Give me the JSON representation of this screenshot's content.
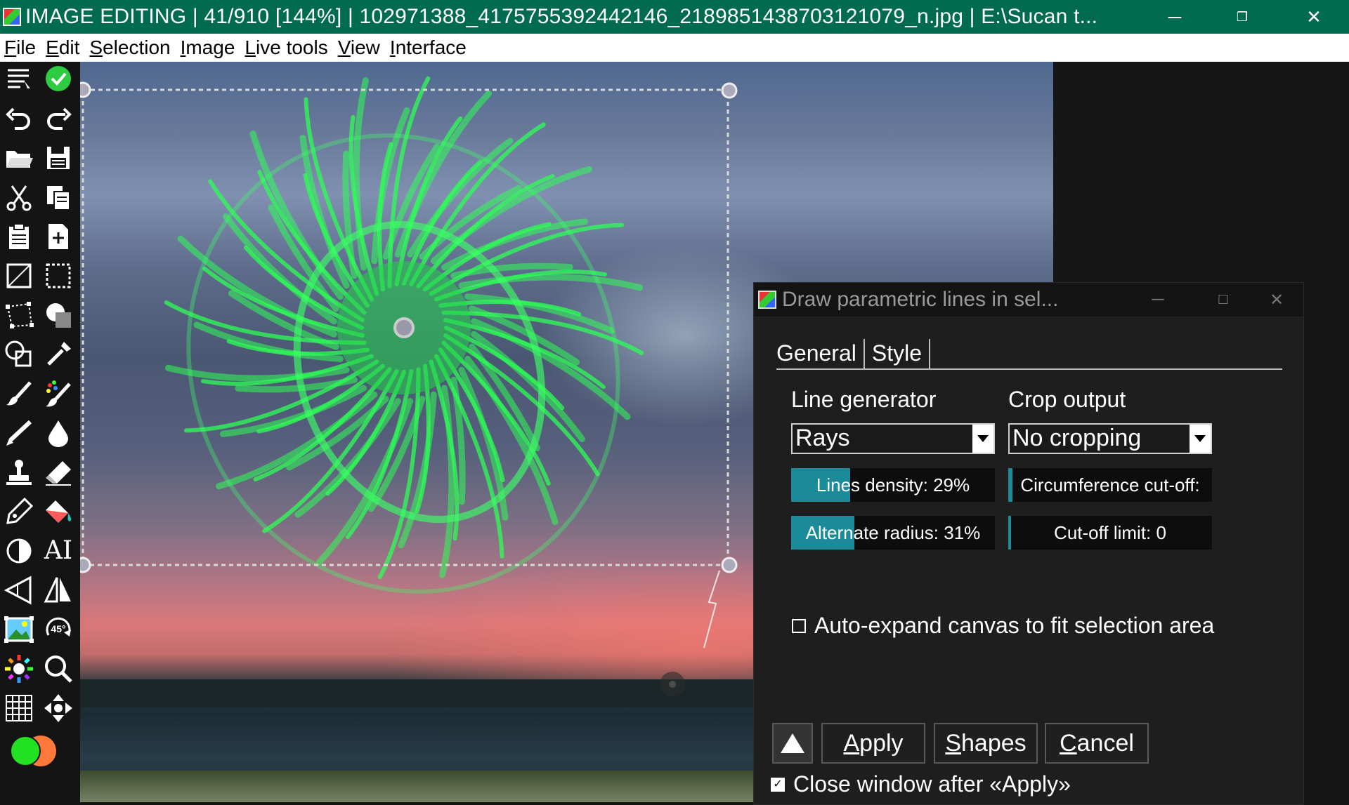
{
  "window": {
    "title": "IMAGE EDITING | 41/910 [144%] | 102971388_4175755392442146_2189851438703121079_n.jpg | E:\\Sucan t...",
    "min_icon": "minimize-icon",
    "max_icon": "restore-icon",
    "close_icon": "close-icon",
    "title_bar_color": "#006b4f"
  },
  "menu": [
    "File",
    "Edit",
    "Selection",
    "Image",
    "Live tools",
    "View",
    "Interface"
  ],
  "toolbox": {
    "tools": [
      "menu-list-icon",
      "apply-check-icon",
      "undo-icon",
      "redo-icon",
      "open-folder-icon",
      "save-icon",
      "cut-icon",
      "copy-icon",
      "paste-icon",
      "new-document-icon",
      "crop-icon",
      "rect-selection-icon",
      "polygon-selection-icon",
      "shading-icon",
      "shapes-icon",
      "color-picker-icon",
      "brush-icon",
      "magic-brush-icon",
      "pencil-icon",
      "blur-drop-icon",
      "stamp-icon",
      "eraser-icon",
      "pen-icon",
      "fill-bucket-icon",
      "contrast-icon",
      "text-icon",
      "perspective-icon",
      "flip-icon",
      "image-adjust-icon",
      "rotate-45-icon",
      "color-wheel-icon",
      "zoom-icon",
      "grid-icon",
      "move-icon"
    ],
    "rotate_label": "45°",
    "text_tool_label": "AI",
    "primary_color": "#22e022",
    "secondary_color": "#ff7a3a"
  },
  "dialog": {
    "title": "Draw parametric lines in sel...",
    "tabs": [
      "General",
      "Style"
    ],
    "line_generator_label": "Line generator",
    "line_generator_value": "Rays",
    "crop_output_label": "Crop output",
    "crop_output_value": "No cropping",
    "sliders": [
      {
        "label": "Lines density: 29%",
        "value": 0.29
      },
      {
        "label": "Circumference cut-off:",
        "value": 0.02
      },
      {
        "label": "Alternate radius: 31%",
        "value": 0.31
      },
      {
        "label": "Cut-off limit: 0",
        "value": 0.0
      }
    ],
    "auto_expand": {
      "label": "Auto-expand canvas to fit selection area",
      "checked": false
    },
    "buttons": {
      "up": "▲",
      "apply": "Apply",
      "shapes": "Shapes",
      "cancel": "Cancel"
    },
    "close_after": {
      "label": "Close window after «Apply»",
      "checked": true
    },
    "accent_color": "#1c8b99"
  }
}
